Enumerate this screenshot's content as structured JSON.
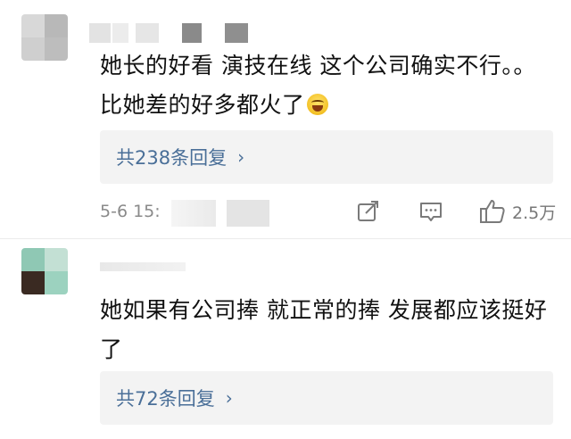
{
  "comments": [
    {
      "text": "她长的好看 演技在线 这个公司确实不行。。比她差的好多都火了",
      "emoji_icon": "laughing-crying-emoji",
      "replies_label": "共238条回复",
      "timestamp": "5-6 15:",
      "likes": "2.5万",
      "actions": [
        "share-icon",
        "comment-icon",
        "like-icon"
      ]
    },
    {
      "text": "她如果有公司捧 就正常的捧 发展都应该挺好了",
      "replies_label": "共72条回复"
    }
  ],
  "colors": {
    "reply_link": "#4a6f98",
    "reply_box_bg": "#f3f3f3",
    "meta_text": "#8a8a8a"
  }
}
